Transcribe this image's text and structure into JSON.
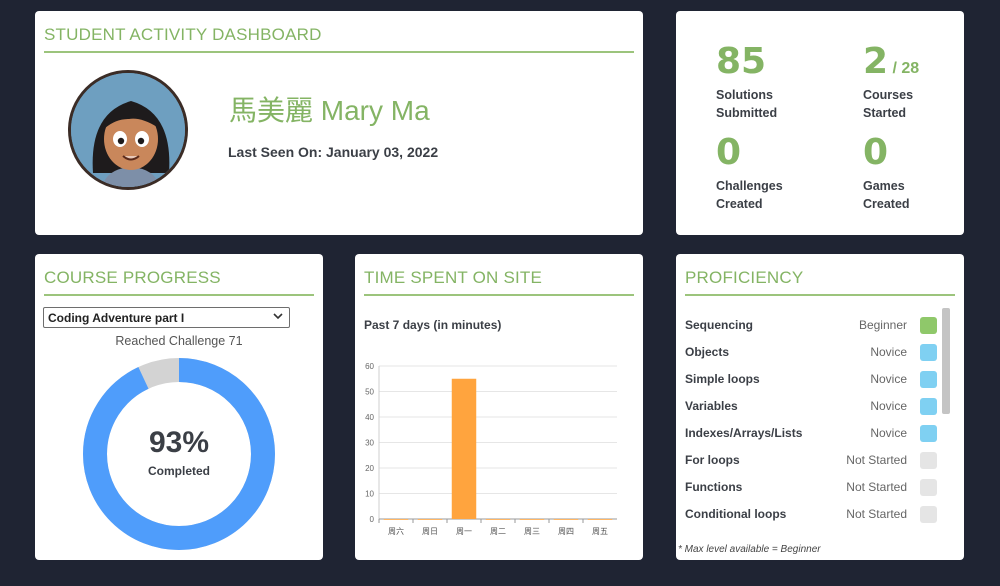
{
  "profile": {
    "title": "STUDENT ACTIVITY DASHBOARD",
    "name": "馬美麗 Mary Ma",
    "last_seen": "Last Seen On: January 03, 2022"
  },
  "stats": [
    {
      "value": "85",
      "total": "",
      "line1": "Solutions",
      "line2": "Submitted"
    },
    {
      "value": "2",
      "total": "/ 28",
      "line1": "Courses",
      "line2": "Started"
    },
    {
      "value": "0",
      "total": "",
      "line1": "Challenges",
      "line2": "Created"
    },
    {
      "value": "0",
      "total": "",
      "line1": "Games",
      "line2": "Created"
    }
  ],
  "course_progress": {
    "title": "COURSE PROGRESS",
    "selected_course": "Coding Adventure part I",
    "reached": "Reached Challenge 71",
    "percent": "93%",
    "percent_value": 93,
    "completed_label": "Completed",
    "colors": {
      "done": "#4f9dfb",
      "remaining": "#d3d3d3"
    }
  },
  "time_spent": {
    "title": "TIME SPENT ON SITE",
    "subtitle": "Past 7 days (in minutes)"
  },
  "chart_data": {
    "type": "bar",
    "categories": [
      "周六",
      "周日",
      "周一",
      "周二",
      "周三",
      "周四",
      "周五"
    ],
    "values": [
      0,
      0,
      55,
      0,
      0,
      0,
      0
    ],
    "ylim": [
      0,
      60
    ],
    "yticks": [
      0,
      10,
      20,
      30,
      40,
      50,
      60
    ],
    "grid": true,
    "bar_color": "#ffa43e",
    "title": "",
    "xlabel": "",
    "ylabel": ""
  },
  "proficiency": {
    "title": "PROFICIENCY",
    "rows": [
      {
        "skill": "Sequencing",
        "level": "Beginner",
        "color": "#8fc86a"
      },
      {
        "skill": "Objects",
        "level": "Novice",
        "color": "#7fd0f2"
      },
      {
        "skill": "Simple loops",
        "level": "Novice",
        "color": "#7fd0f2"
      },
      {
        "skill": "Variables",
        "level": "Novice",
        "color": "#7fd0f2"
      },
      {
        "skill": "Indexes/Arrays/Lists",
        "level": "Novice",
        "color": "#7fd0f2"
      },
      {
        "skill": "For loops",
        "level": "Not Started",
        "color": "#e5e5e5"
      },
      {
        "skill": "Functions",
        "level": "Not Started",
        "color": "#e5e5e5"
      },
      {
        "skill": "Conditional loops",
        "level": "Not Started",
        "color": "#e5e5e5"
      }
    ],
    "note": "* Max level available = Beginner"
  }
}
